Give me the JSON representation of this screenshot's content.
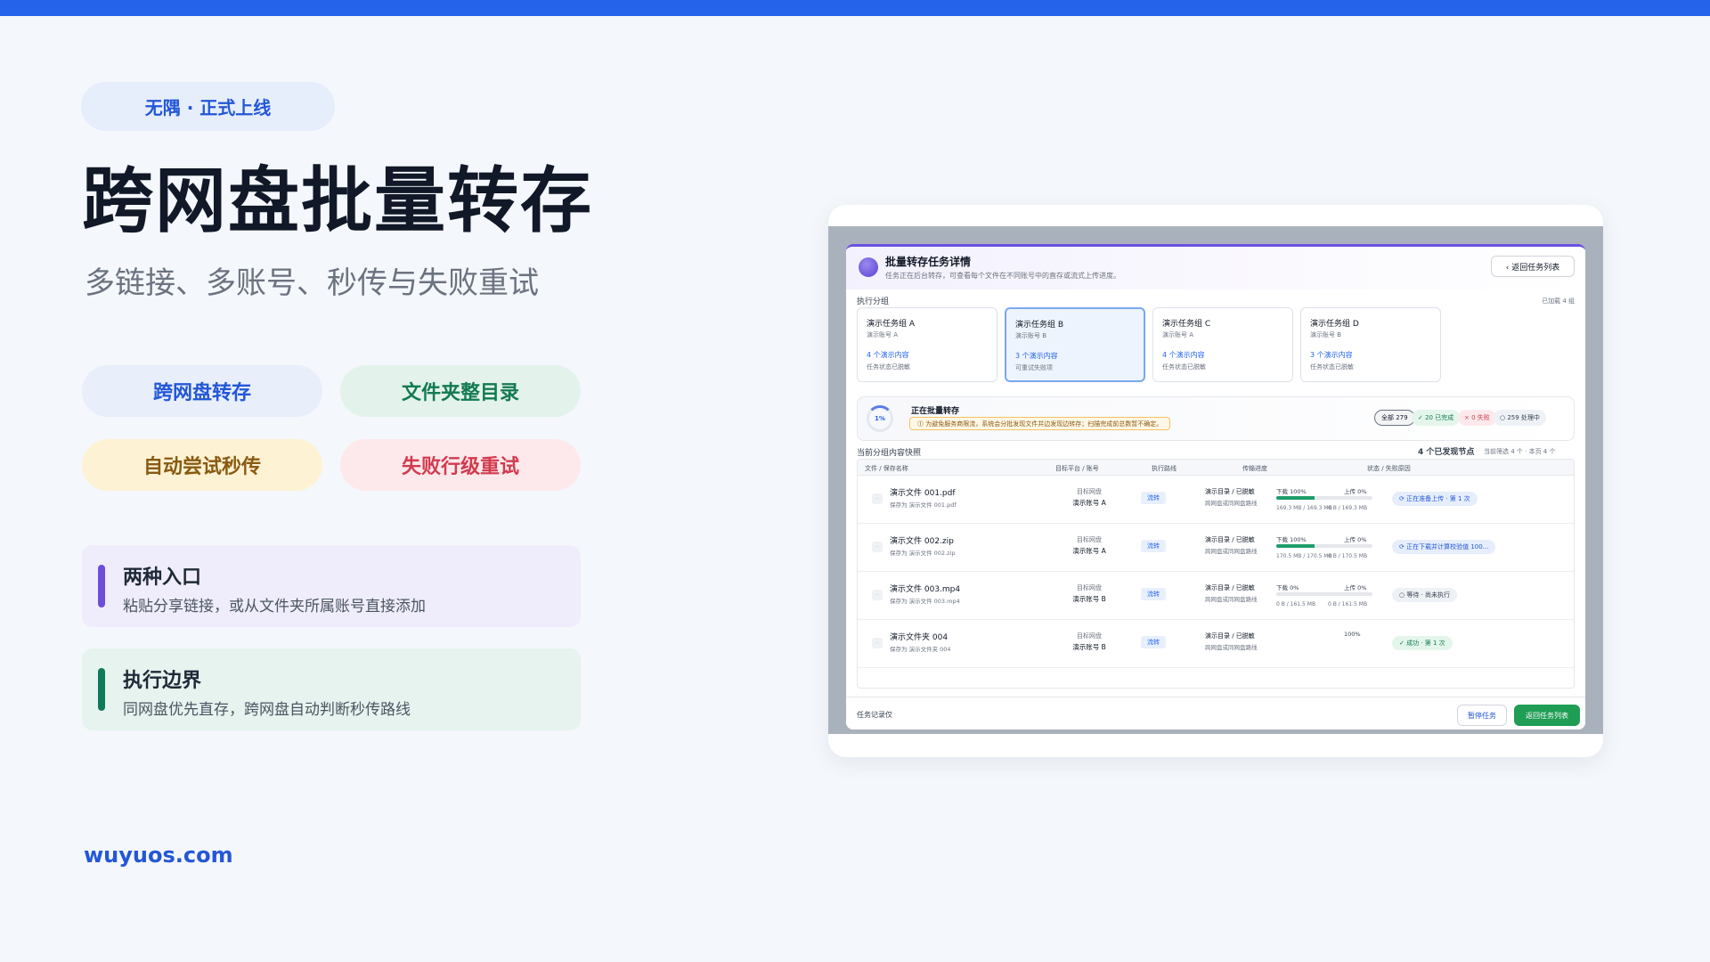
{
  "badge": "无隅 · 正式上线",
  "hero": {
    "title": "跨网盘批量转存",
    "subtitle": "多链接、多账号、秒传与失败重试"
  },
  "tags": [
    "跨网盘转存",
    "文件夹整目录",
    "自动尝试秒传",
    "失败行级重试"
  ],
  "features": [
    {
      "title": "两种入口",
      "desc": "粘贴分享链接，或从文件夹所属账号直接添加"
    },
    {
      "title": "执行边界",
      "desc": "同网盘优先直存，跨网盘自动判断秒传路线"
    }
  ],
  "domain": "wuyuos.com",
  "colors": {
    "accent": "#2563eb",
    "success": "#1f9d55",
    "purple": "#6d4fd6",
    "danger": "#d23b4f"
  },
  "modal": {
    "title": "批量转存任务详情",
    "subtitle": "任务正在后台转存，可查看每个文件在不同账号中的直存或流式上传进度。",
    "back_button": "‹ 返回任务列表",
    "groups_label": "执行分组",
    "groups_loaded": "已加载 4 组",
    "groups": [
      {
        "name": "演示任务组 A",
        "account": "演示账号 A",
        "count": "4 个演示内容",
        "state": "任务状态已脱敏"
      },
      {
        "name": "演示任务组 B",
        "account": "演示账号 B",
        "count": "3 个演示内容",
        "state": "可重试失败项"
      },
      {
        "name": "演示任务组 C",
        "account": "演示账号 A",
        "count": "4 个演示内容",
        "state": "任务状态已脱敏"
      },
      {
        "name": "演示任务组 D",
        "account": "演示账号 B",
        "count": "3 个演示内容",
        "state": "任务状态已脱敏"
      }
    ],
    "status": {
      "progress": "1%",
      "title": "正在批量转存",
      "warning": "⓵ 为避免服务商限流，系统会分批发现文件并边发现边转存；扫描完成前总数暂不确定。",
      "chip_all": "全部 279",
      "chip_ok": "✓ 20 已完成",
      "chip_fail": "× 0 失败",
      "chip_proc": "○ 259 处理中"
    },
    "snapshot_label": "当前分组内容快照",
    "snapshot_right": "4 个已发现节点",
    "snapshot_right_small": "当前筛选 4 个 · 本页 4 个",
    "columns": [
      "文件 / 保存名称",
      "目标平台 / 账号",
      "执行路线",
      "传输进度",
      "状态 / 失败原因"
    ],
    "rows": [
      {
        "check": "·",
        "name": "演示文件 001.pdf",
        "save": "保存为 演示文件 001.pdf",
        "platform": "目标网盘",
        "account": "演示账号 A",
        "route": "流转",
        "dir": "演示目录 / 已脱敏",
        "dir2": "跨网盘或同网盘路线",
        "dl": "下载 100%",
        "up": "上传 0%",
        "progress": 0.4,
        "size": "169.3 MB / 169.3 MB",
        "size2": "0 B / 169.3 MB",
        "status": "⟳ 正在准备上传 · 第 1 次",
        "status_kind": "blue"
      },
      {
        "check": "·",
        "name": "演示文件 002.zip",
        "save": "保存为 演示文件 002.zip",
        "platform": "目标网盘",
        "account": "演示账号 A",
        "route": "流转",
        "dir": "演示目录 / 已脱敏",
        "dir2": "跨网盘或同网盘路线",
        "dl": "下载 100%",
        "up": "上传 0%",
        "progress": 0.4,
        "size": "170.5 MB / 170.5 MB",
        "size2": "0 B / 170.5 MB",
        "status": "⟳ 正在下载并计算校验值 100...",
        "status_kind": "blue"
      },
      {
        "check": "·",
        "name": "演示文件 003.mp4",
        "save": "保存为 演示文件 003.mp4",
        "platform": "目标网盘",
        "account": "演示账号 B",
        "route": "流转",
        "dir": "演示目录 / 已脱敏",
        "dir2": "跨网盘或同网盘路线",
        "dl": "下载 0%",
        "up": "上传 0%",
        "progress": 0.0,
        "size": "0 B / 161.5 MB",
        "size2": "0 B / 161.5 MB",
        "status": "○ 等待 · 尚未执行",
        "status_kind": "gray"
      },
      {
        "check": "·",
        "name": "演示文件夹 004",
        "save": "保存为 演示文件夹 004",
        "platform": "目标网盘",
        "account": "演示账号 B",
        "route": "流转",
        "dir": "演示目录 / 已脱敏",
        "dir2": "跨网盘或同网盘路线",
        "dl": "",
        "up": "100%",
        "progress": 1.0,
        "size": "",
        "size2": "",
        "status": "✓ 成功 · 第 1 次",
        "status_kind": "blue"
      }
    ],
    "footer_label": "任务记录仅",
    "pause_button": "暂停任务",
    "return_button": "返回任务列表"
  }
}
